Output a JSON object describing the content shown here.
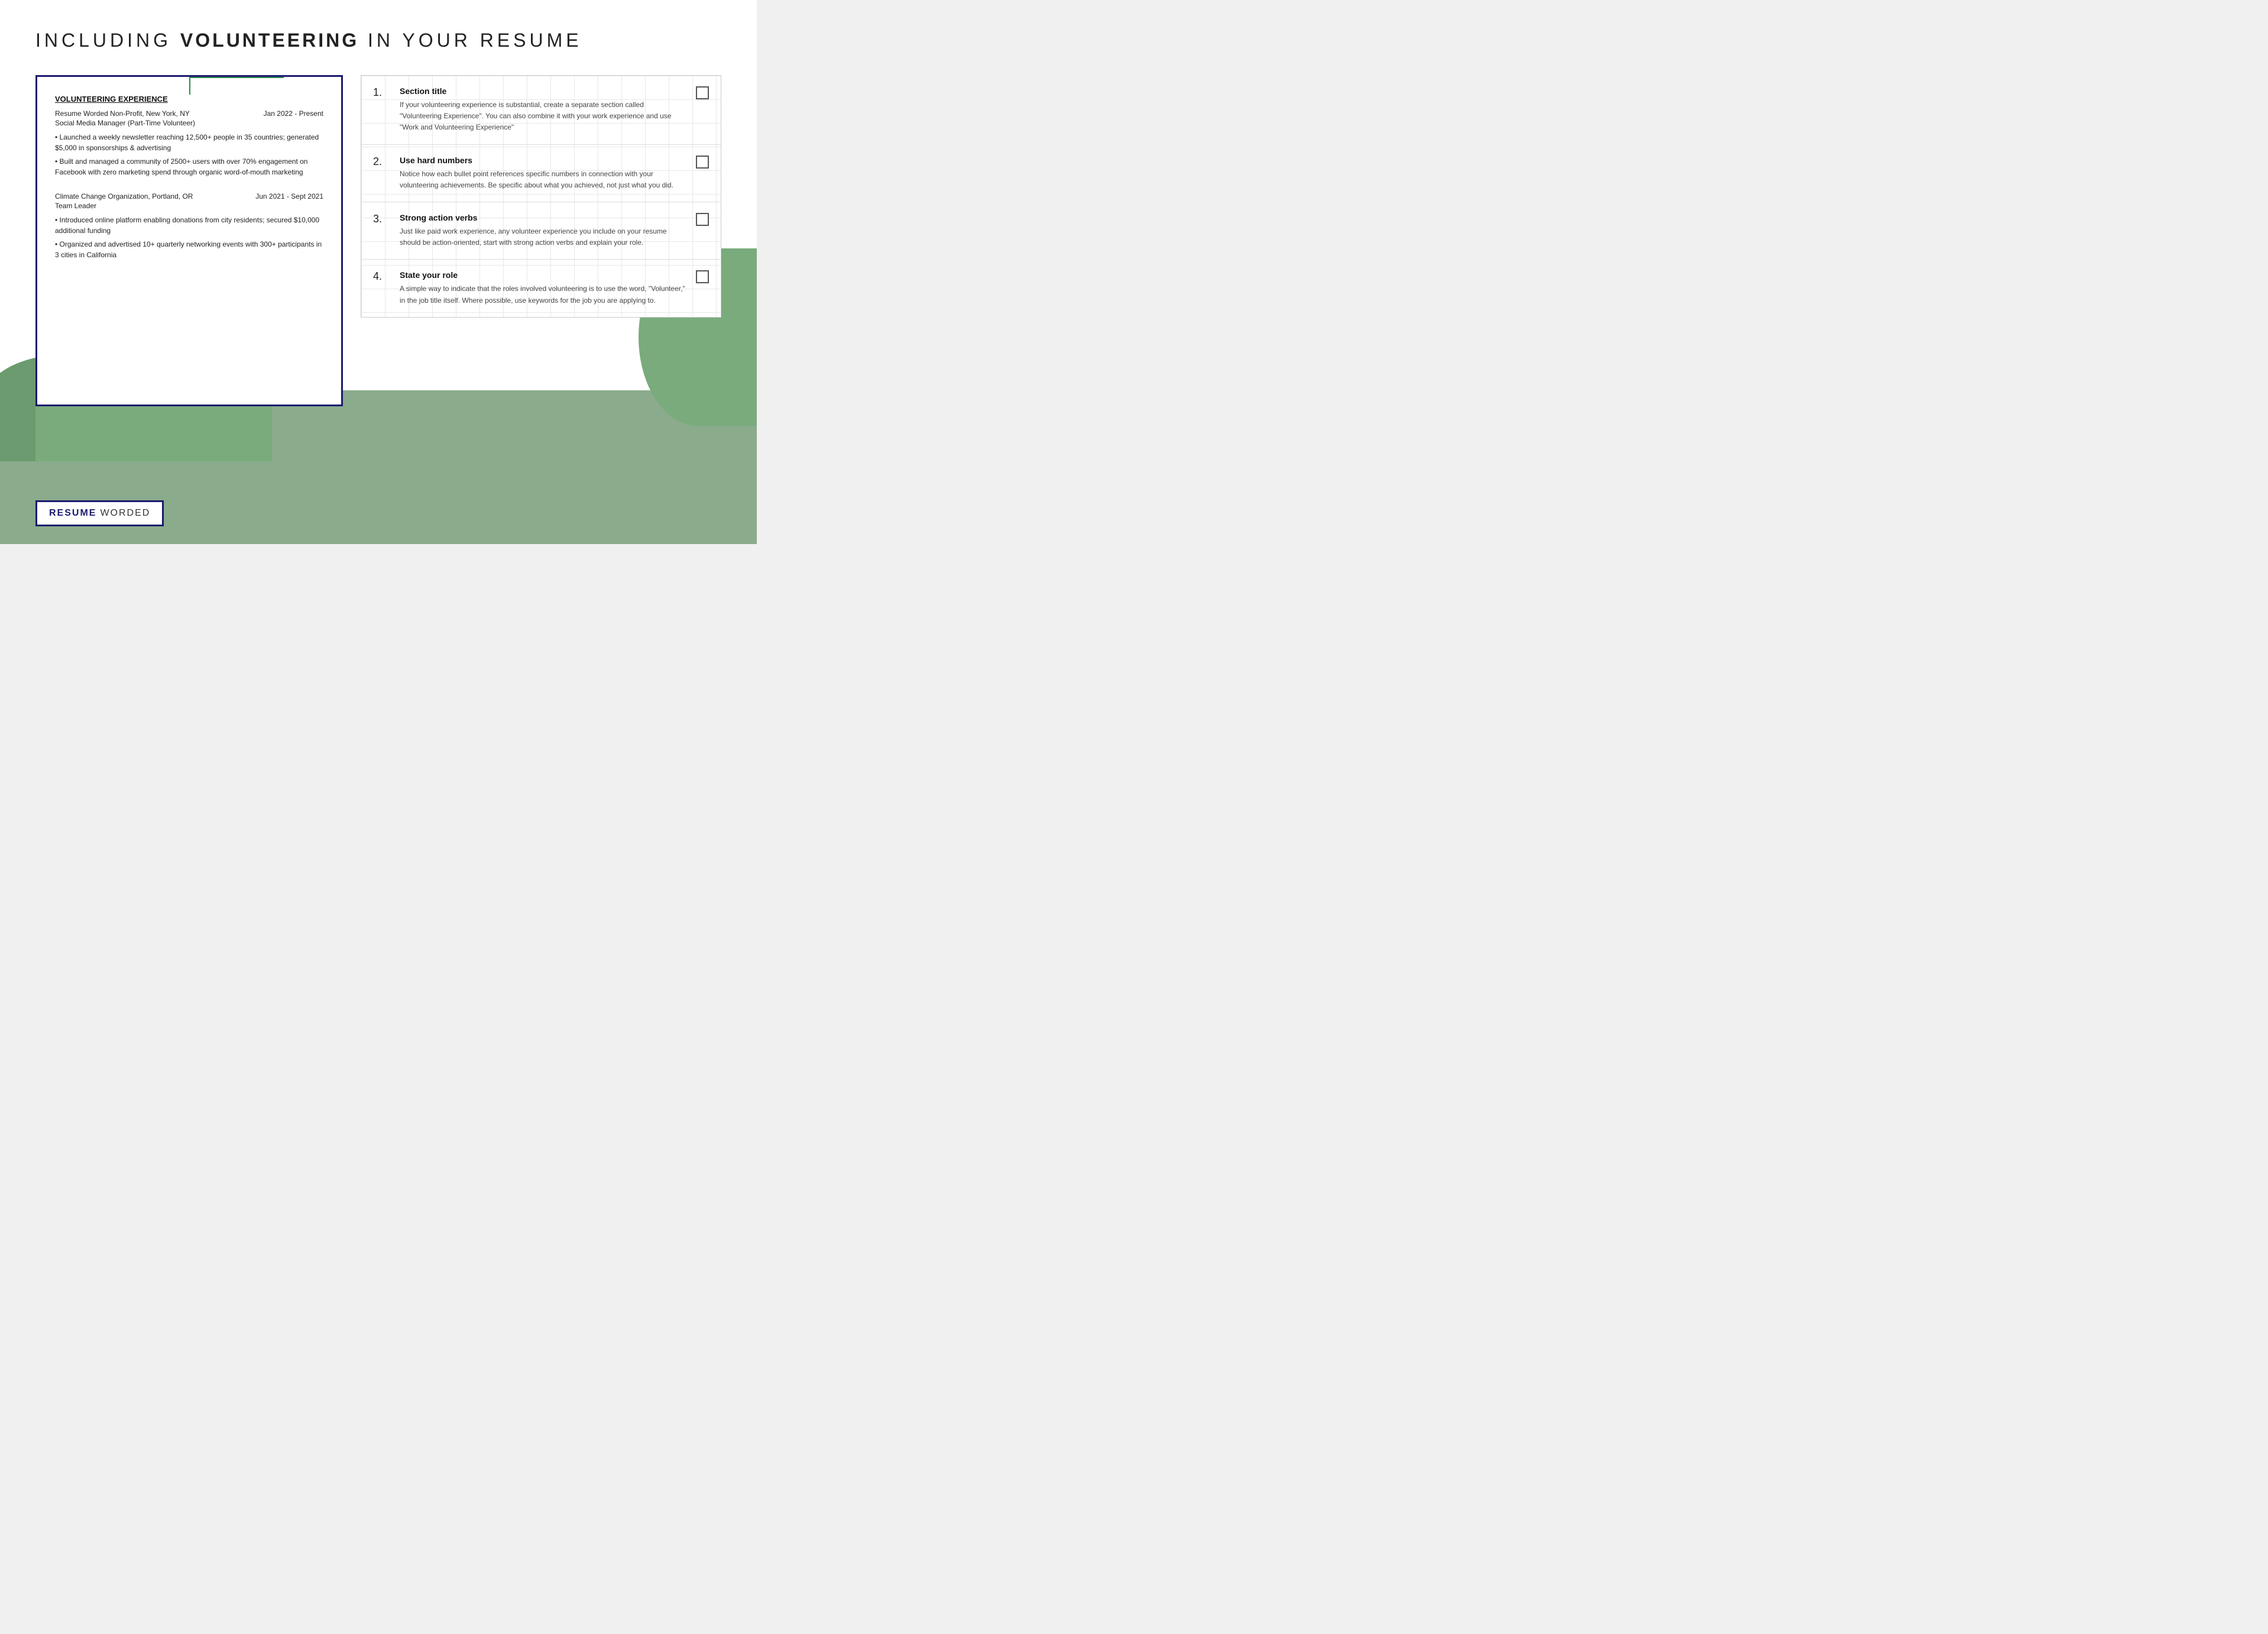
{
  "page": {
    "title_prefix": "INCLUDING ",
    "title_bold": "VOLUNTEERING",
    "title_suffix": " IN YOUR RESUME"
  },
  "resume_card": {
    "section_title": "VOLUNTEERING EXPERIENCE",
    "job1": {
      "org": "Resume Worded Non-Profit, New York, NY",
      "date": "Jan 2022 - Present",
      "role": "Social Media Manager (Part-Time Volunteer)",
      "bullet1": "• Launched a weekly newsletter reaching 12,500+ people in 35 countries; generated $5,000 in sponsorships & advertising",
      "bullet2": "• Built and managed a community of 2500+ users with over 70% engagement on Facebook with zero marketing spend through organic word-of-mouth marketing"
    },
    "job2": {
      "org": "Climate Change Organization, Portland, OR",
      "date": "Jun 2021 - Sept 2021",
      "role": "Team Leader",
      "bullet1": "• Introduced online platform enabling donations from city residents; secured $10,000 additional funding",
      "bullet2": "• Organized and advertised 10+ quarterly networking events with 300+ participants in 3 cities in California"
    }
  },
  "tips": [
    {
      "number": "1.",
      "title": "Section title",
      "description": "If your volunteering experience is substantial, create a separate section called \"Volunteering Experience\". You can also combine it with your work experience and use \"Work and Volunteering Experience\""
    },
    {
      "number": "2.",
      "title": "Use hard numbers",
      "description": "Notice how each bullet point references specific numbers in connection with your volunteering achievements. Be specific about what you achieved, not just what you did."
    },
    {
      "number": "3.",
      "title": "Strong action verbs",
      "description": "Just like paid work experience, any volunteer experience you include on your resume should be action-oriented, start with strong action verbs and explain your role."
    },
    {
      "number": "4.",
      "title": "State your role",
      "description": "A simple way to indicate that the roles involved volunteering is to use the word, \"Volunteer,\" in the job title itself. Where possible, use keywords for the job you are applying to."
    }
  ],
  "branding": {
    "resume": "RESUME",
    "worded": "WORDED"
  },
  "colors": {
    "navy": "#1a1a6e",
    "green": "#2d8a4e",
    "background_green": "#8aab8c"
  }
}
